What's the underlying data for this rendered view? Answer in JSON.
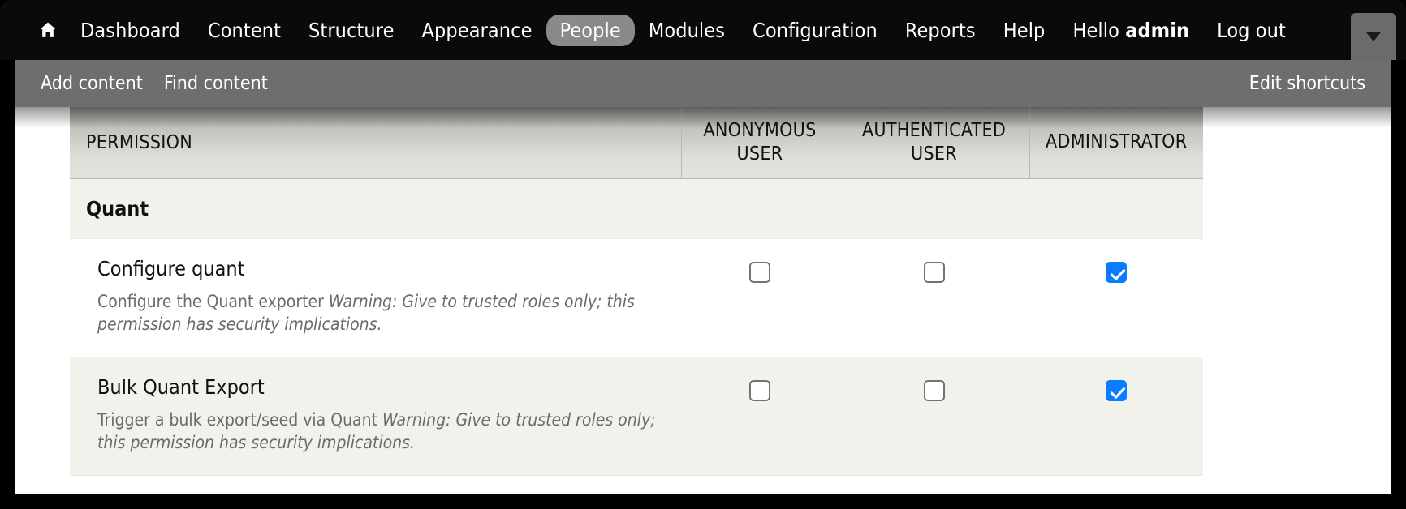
{
  "toolbar": {
    "home_icon": "home-icon",
    "items": [
      {
        "label": "Dashboard",
        "active": false
      },
      {
        "label": "Content",
        "active": false
      },
      {
        "label": "Structure",
        "active": false
      },
      {
        "label": "Appearance",
        "active": false
      },
      {
        "label": "People",
        "active": true
      },
      {
        "label": "Modules",
        "active": false
      },
      {
        "label": "Configuration",
        "active": false
      },
      {
        "label": "Reports",
        "active": false
      },
      {
        "label": "Help",
        "active": false
      }
    ],
    "greeting_prefix": "Hello ",
    "greeting_user": "admin",
    "logout_label": "Log out",
    "collapse_icon": "chevron-down-icon"
  },
  "shortcuts": {
    "items": [
      {
        "label": "Add content"
      },
      {
        "label": "Find content"
      }
    ],
    "edit_label": "Edit shortcuts"
  },
  "permissions_table": {
    "columns": [
      {
        "key": "permission",
        "label": "PERMISSION"
      },
      {
        "key": "anonymous",
        "label": "ANONYMOUS USER"
      },
      {
        "key": "authenticated",
        "label": "AUTHENTICATED USER"
      },
      {
        "key": "administrator",
        "label": "ADMINISTRATOR"
      }
    ],
    "section_label": "Quant",
    "rows": [
      {
        "title": "Configure quant",
        "description_plain": "Configure the Quant exporter ",
        "description_warning": "Warning: Give to trusted roles only; this permission has security implications.",
        "anonymous_checked": false,
        "authenticated_checked": false,
        "administrator_checked": true
      },
      {
        "title": "Bulk Quant Export",
        "description_plain": "Trigger a bulk export/seed via Quant ",
        "description_warning": "Warning: Give to trusted roles only; this permission has security implications.",
        "anonymous_checked": false,
        "authenticated_checked": false,
        "administrator_checked": true
      }
    ]
  },
  "colors": {
    "toolbar_bg": "#0a0a0a",
    "shortcut_bg": "#6e6e6e",
    "active_tab_bg": "#8a8a8a",
    "checkbox_checked": "#0a7cff",
    "row_stripe": "#f2f2ec",
    "header_gradient_top": "#9b9b96",
    "header_gradient_bottom": "#e3e3dd"
  }
}
